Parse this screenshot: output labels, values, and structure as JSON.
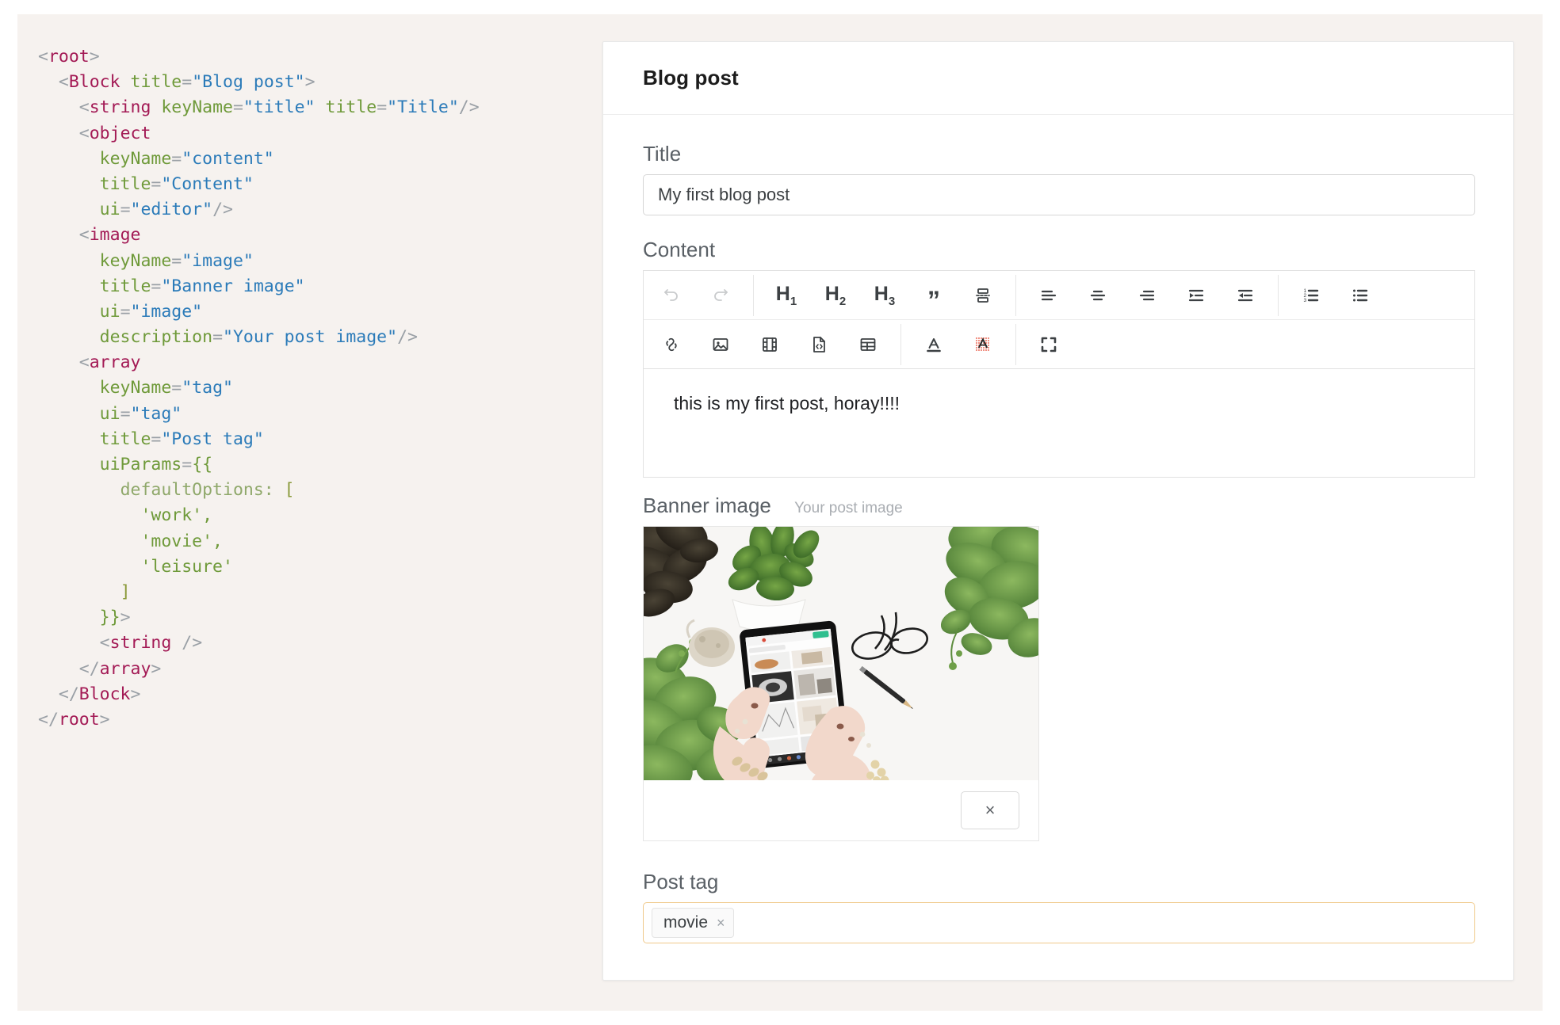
{
  "code": {
    "language": "jsx-schema",
    "lines": [
      [
        {
          "t": "punc",
          "s": "<"
        },
        {
          "t": "tag",
          "s": "root"
        },
        {
          "t": "punc",
          "s": ">"
        }
      ],
      [
        {
          "t": "plain",
          "s": "  "
        },
        {
          "t": "punc",
          "s": "<"
        },
        {
          "t": "tag",
          "s": "Block"
        },
        {
          "t": "plain",
          "s": " "
        },
        {
          "t": "attr",
          "s": "title"
        },
        {
          "t": "punc",
          "s": "="
        },
        {
          "t": "str",
          "s": "\"Blog post\""
        },
        {
          "t": "punc",
          "s": ">"
        }
      ],
      [
        {
          "t": "plain",
          "s": "    "
        },
        {
          "t": "punc",
          "s": "<"
        },
        {
          "t": "tag",
          "s": "string"
        },
        {
          "t": "plain",
          "s": " "
        },
        {
          "t": "attr",
          "s": "keyName"
        },
        {
          "t": "punc",
          "s": "="
        },
        {
          "t": "str",
          "s": "\"title\""
        },
        {
          "t": "plain",
          "s": " "
        },
        {
          "t": "attr",
          "s": "title"
        },
        {
          "t": "punc",
          "s": "="
        },
        {
          "t": "str",
          "s": "\"Title\""
        },
        {
          "t": "punc",
          "s": "/>"
        }
      ],
      [
        {
          "t": "plain",
          "s": "    "
        },
        {
          "t": "punc",
          "s": "<"
        },
        {
          "t": "tag",
          "s": "object"
        }
      ],
      [
        {
          "t": "plain",
          "s": "      "
        },
        {
          "t": "attr",
          "s": "keyName"
        },
        {
          "t": "punc",
          "s": "="
        },
        {
          "t": "str",
          "s": "\"content\""
        }
      ],
      [
        {
          "t": "plain",
          "s": "      "
        },
        {
          "t": "attr",
          "s": "title"
        },
        {
          "t": "punc",
          "s": "="
        },
        {
          "t": "str",
          "s": "\"Content\""
        }
      ],
      [
        {
          "t": "plain",
          "s": "      "
        },
        {
          "t": "attr",
          "s": "ui"
        },
        {
          "t": "punc",
          "s": "="
        },
        {
          "t": "str",
          "s": "\"editor\""
        },
        {
          "t": "punc",
          "s": "/>"
        }
      ],
      [
        {
          "t": "plain",
          "s": "    "
        },
        {
          "t": "punc",
          "s": "<"
        },
        {
          "t": "tag",
          "s": "image"
        }
      ],
      [
        {
          "t": "plain",
          "s": "      "
        },
        {
          "t": "attr",
          "s": "keyName"
        },
        {
          "t": "punc",
          "s": "="
        },
        {
          "t": "str",
          "s": "\"image\""
        }
      ],
      [
        {
          "t": "plain",
          "s": "      "
        },
        {
          "t": "attr",
          "s": "title"
        },
        {
          "t": "punc",
          "s": "="
        },
        {
          "t": "str",
          "s": "\"Banner image\""
        }
      ],
      [
        {
          "t": "plain",
          "s": "      "
        },
        {
          "t": "attr",
          "s": "ui"
        },
        {
          "t": "punc",
          "s": "="
        },
        {
          "t": "str",
          "s": "\"image\""
        }
      ],
      [
        {
          "t": "plain",
          "s": "      "
        },
        {
          "t": "attr",
          "s": "description"
        },
        {
          "t": "punc",
          "s": "="
        },
        {
          "t": "str",
          "s": "\"Your post image\""
        },
        {
          "t": "punc",
          "s": "/>"
        }
      ],
      [
        {
          "t": "plain",
          "s": "    "
        },
        {
          "t": "punc",
          "s": "<"
        },
        {
          "t": "tag",
          "s": "array"
        }
      ],
      [
        {
          "t": "plain",
          "s": "      "
        },
        {
          "t": "attr",
          "s": "keyName"
        },
        {
          "t": "punc",
          "s": "="
        },
        {
          "t": "str",
          "s": "\"tag\""
        }
      ],
      [
        {
          "t": "plain",
          "s": "      "
        },
        {
          "t": "attr",
          "s": "ui"
        },
        {
          "t": "punc",
          "s": "="
        },
        {
          "t": "str",
          "s": "\"tag\""
        }
      ],
      [
        {
          "t": "plain",
          "s": "      "
        },
        {
          "t": "attr",
          "s": "title"
        },
        {
          "t": "punc",
          "s": "="
        },
        {
          "t": "str",
          "s": "\"Post tag\""
        }
      ],
      [
        {
          "t": "plain",
          "s": "      "
        },
        {
          "t": "attr",
          "s": "uiParams"
        },
        {
          "t": "punc",
          "s": "="
        },
        {
          "t": "brace",
          "s": "{{"
        }
      ],
      [
        {
          "t": "plain",
          "s": "        "
        },
        {
          "t": "key",
          "s": "defaultOptions: "
        },
        {
          "t": "brk",
          "s": "["
        }
      ],
      [
        {
          "t": "plain",
          "s": "          "
        },
        {
          "t": "val",
          "s": "'work',"
        }
      ],
      [
        {
          "t": "plain",
          "s": "          "
        },
        {
          "t": "val",
          "s": "'movie',"
        }
      ],
      [
        {
          "t": "plain",
          "s": "          "
        },
        {
          "t": "val",
          "s": "'leisure'"
        }
      ],
      [
        {
          "t": "plain",
          "s": "        "
        },
        {
          "t": "brk",
          "s": "]"
        }
      ],
      [
        {
          "t": "plain",
          "s": "      "
        },
        {
          "t": "brace",
          "s": "}}"
        },
        {
          "t": "punc",
          "s": ">"
        }
      ],
      [
        {
          "t": "plain",
          "s": "      "
        },
        {
          "t": "punc",
          "s": "<"
        },
        {
          "t": "tag",
          "s": "string"
        },
        {
          "t": "plain",
          "s": " "
        },
        {
          "t": "punc",
          "s": "/>"
        }
      ],
      [
        {
          "t": "plain",
          "s": "    "
        },
        {
          "t": "punc",
          "s": "</"
        },
        {
          "t": "tag",
          "s": "array"
        },
        {
          "t": "punc",
          "s": ">"
        }
      ],
      [
        {
          "t": "plain",
          "s": "  "
        },
        {
          "t": "punc",
          "s": "</"
        },
        {
          "t": "tag",
          "s": "Block"
        },
        {
          "t": "punc",
          "s": ">"
        }
      ],
      [
        {
          "t": "punc",
          "s": "</"
        },
        {
          "t": "tag",
          "s": "root"
        },
        {
          "t": "punc",
          "s": ">"
        }
      ]
    ]
  },
  "form": {
    "header_title": "Blog post",
    "title_field": {
      "label": "Title",
      "value": "My first blog post",
      "placeholder": ""
    },
    "content_field": {
      "label": "Content",
      "body_text": "this is my first post, horay!!!!",
      "toolbar_row1": [
        {
          "name": "undo-icon",
          "label": "Undo",
          "dim": true
        },
        {
          "name": "redo-icon",
          "label": "Redo",
          "dim": true
        },
        {
          "sep": true
        },
        {
          "name": "heading-1-icon",
          "label": "H1"
        },
        {
          "name": "heading-2-icon",
          "label": "H2"
        },
        {
          "name": "heading-3-icon",
          "label": "H3"
        },
        {
          "name": "blockquote-icon",
          "label": "Quote"
        },
        {
          "name": "page-break-icon",
          "label": "Page break"
        },
        {
          "sep": true
        },
        {
          "name": "align-left-icon",
          "label": "Align left"
        },
        {
          "name": "align-center-icon",
          "label": "Align center"
        },
        {
          "name": "align-right-icon",
          "label": "Align right"
        },
        {
          "name": "indent-icon",
          "label": "Indent"
        },
        {
          "name": "outdent-icon",
          "label": "Outdent"
        },
        {
          "sep": true
        },
        {
          "name": "ordered-list-icon",
          "label": "Numbered list"
        },
        {
          "name": "bullet-list-icon",
          "label": "Bullet list"
        }
      ],
      "toolbar_row2": [
        {
          "name": "link-icon",
          "label": "Link"
        },
        {
          "name": "image-icon",
          "label": "Image"
        },
        {
          "name": "video-icon",
          "label": "Video"
        },
        {
          "name": "code-block-icon",
          "label": "Code block"
        },
        {
          "name": "table-icon",
          "label": "Table"
        },
        {
          "sep": true
        },
        {
          "name": "text-color-icon",
          "label": "Text color"
        },
        {
          "name": "highlight-color-icon",
          "label": "Highlight color"
        },
        {
          "sep": true
        },
        {
          "name": "fullscreen-icon",
          "label": "Fullscreen"
        }
      ]
    },
    "image_field": {
      "label": "Banner image",
      "description": "Your post image",
      "remove_label": "×"
    },
    "tag_field": {
      "label": "Post tag",
      "chips": [
        {
          "label": "movie",
          "remove": "×"
        }
      ],
      "focus_border_color": "#f0c98a"
    }
  },
  "colors": {
    "page_background": "#f6f2ef",
    "card_background": "#ffffff",
    "accent_tag_border": "#f0c98a",
    "code_tag": "#a31a55",
    "code_attr": "#6f9a3a",
    "code_string": "#2b7bb9",
    "code_punctuation": "#9aa0a6"
  }
}
